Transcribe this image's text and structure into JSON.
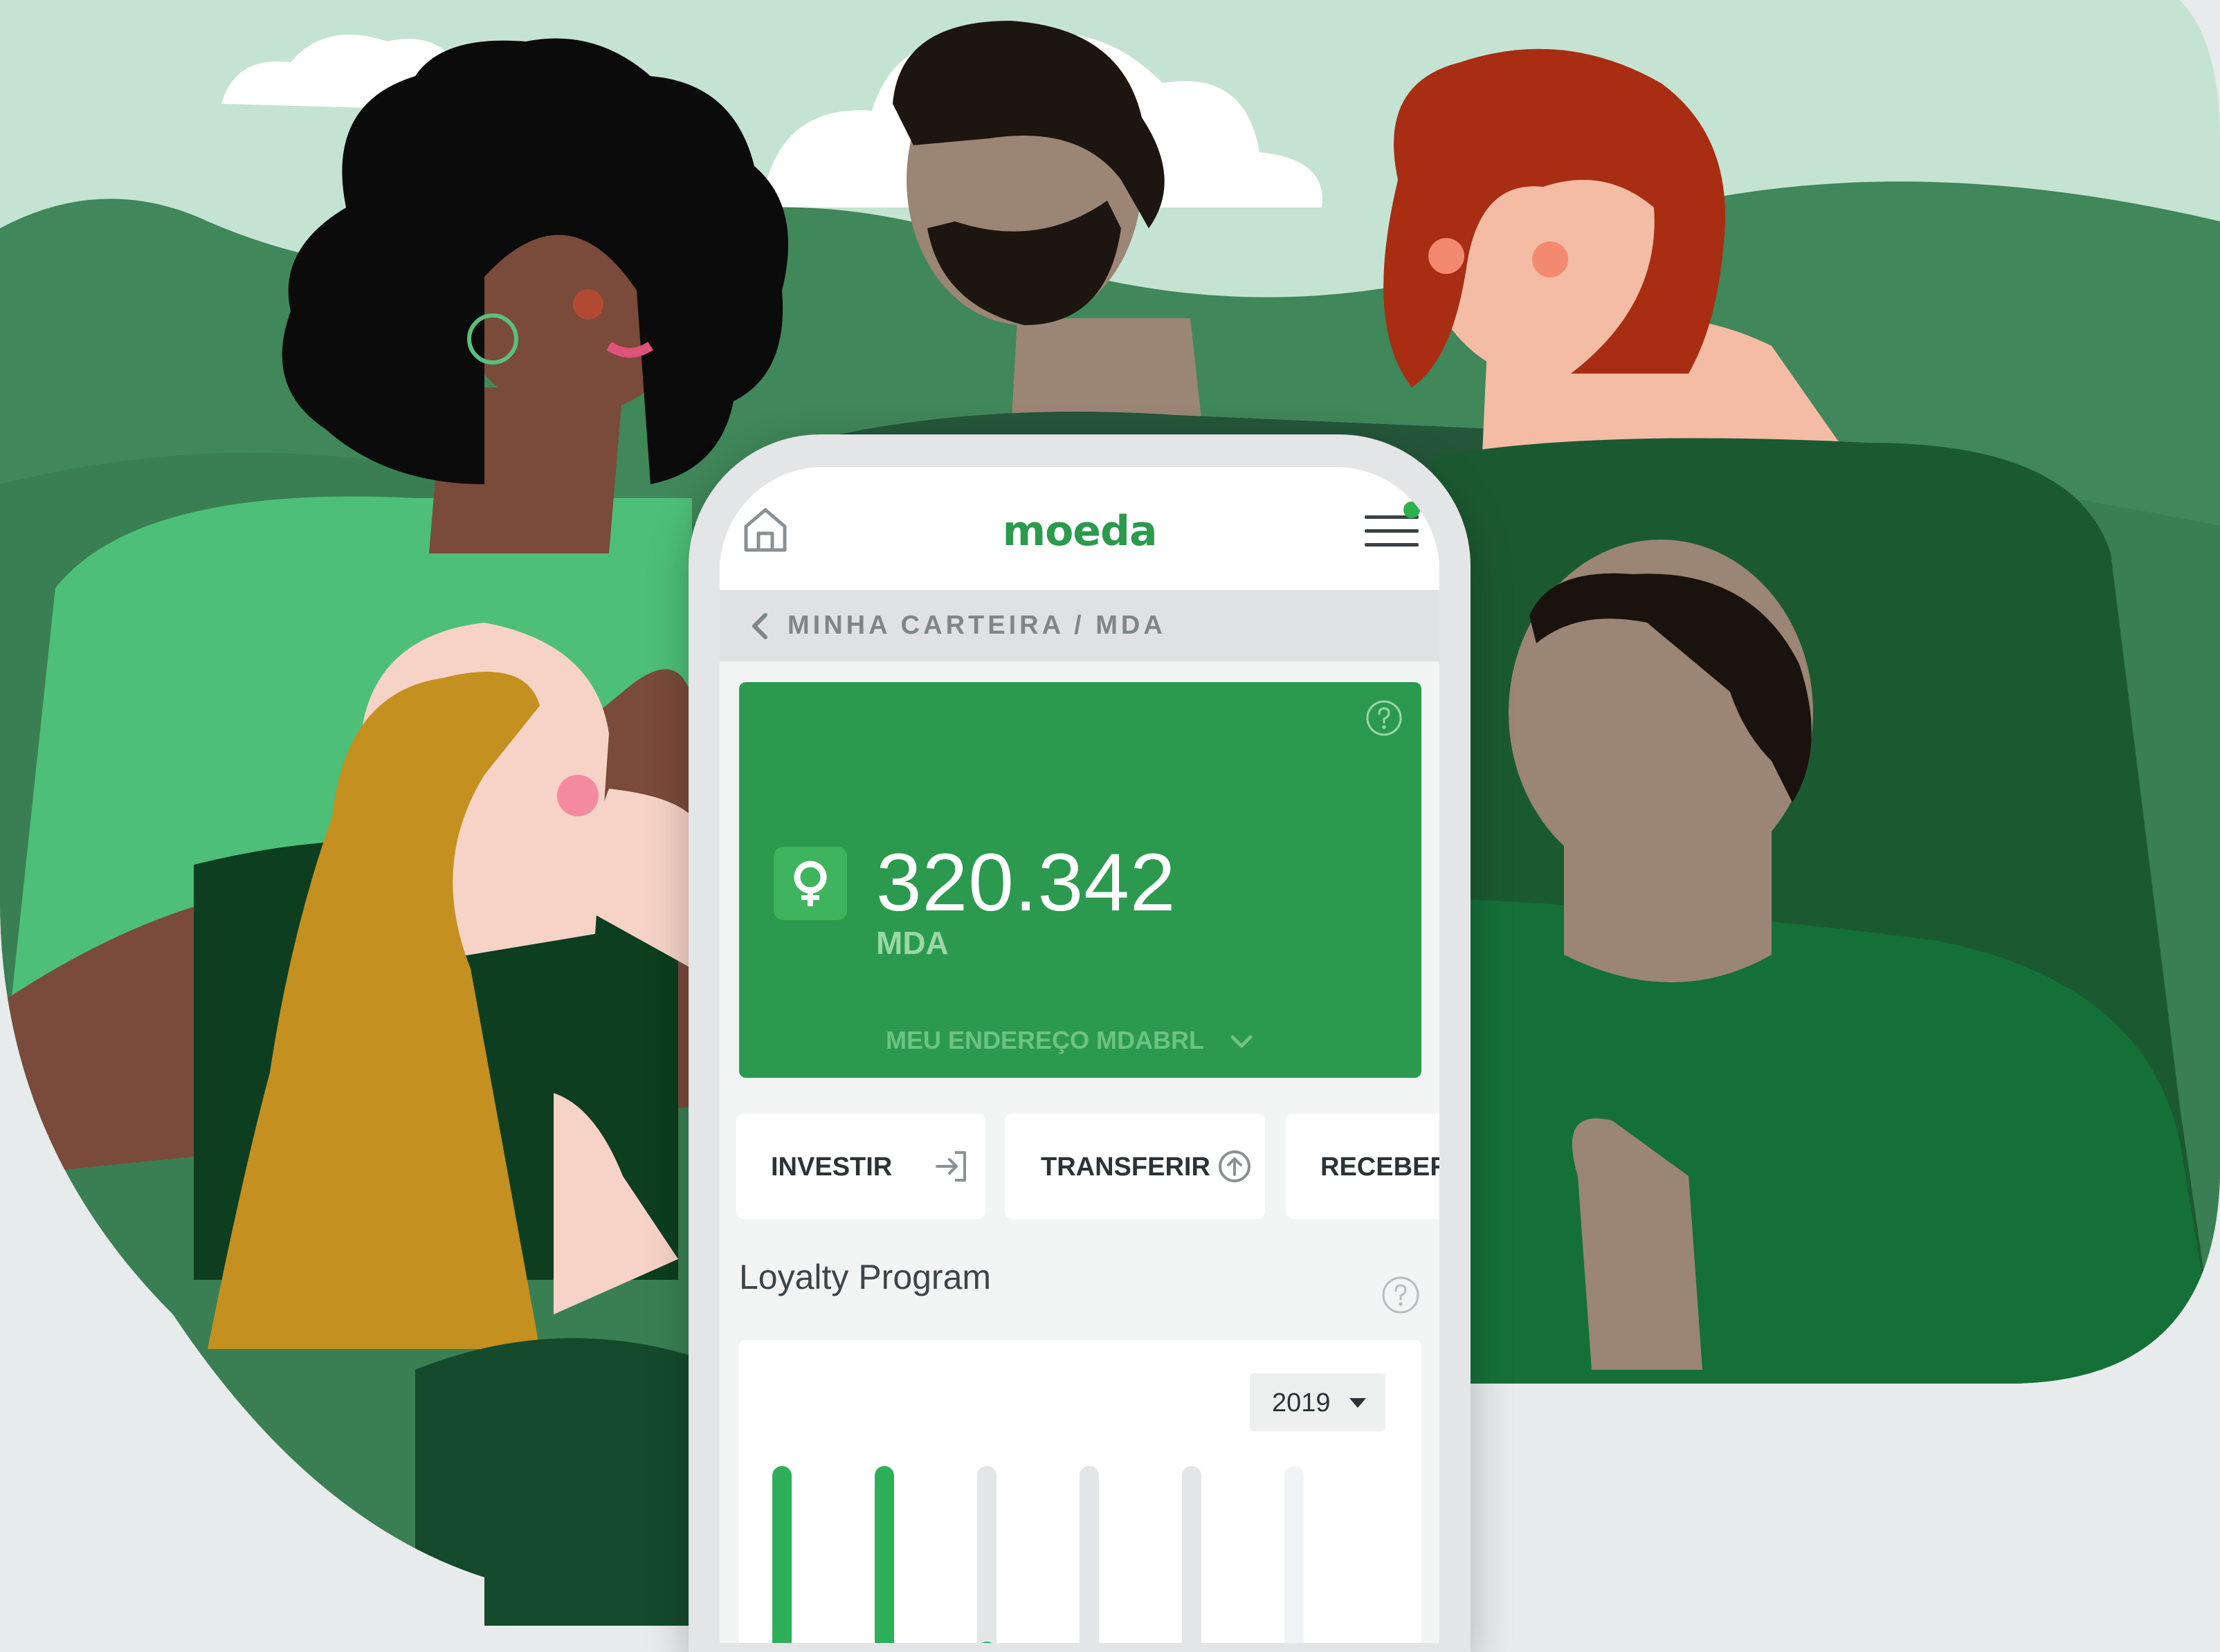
{
  "app": {
    "logo": "moeda",
    "breadcrumb": "MINHA CARTEIRA / MDA"
  },
  "wallet": {
    "balance": "320.342",
    "currency": "MDA",
    "address_toggle": "MEU ENDEREÇO MDABRL"
  },
  "actions": {
    "invest": "INVESTIR",
    "transfer": "TRANSFERIR",
    "receive": "RECEBER"
  },
  "loyalty": {
    "title": "Loyalty Program",
    "year": "2019",
    "bar_levels": [
      1.0,
      1.0,
      0.2,
      0.0,
      0.0,
      0.0
    ]
  },
  "icons": {
    "home": "home-icon",
    "menu": "hamburger-menu-icon",
    "notification": "notification-dot",
    "back": "chevron-left-icon",
    "help": "question-circle-icon",
    "token": "moeda-token-icon",
    "invest": "sign-in-arrow-icon",
    "transfer": "arrow-up-circle-icon",
    "year_dropdown": "caret-down-icon"
  },
  "colors": {
    "brand_green": "#2c9a4e",
    "bar_green": "#2eb05a",
    "bar_track": "#e3e5e6",
    "notification": "#2bb04d"
  }
}
